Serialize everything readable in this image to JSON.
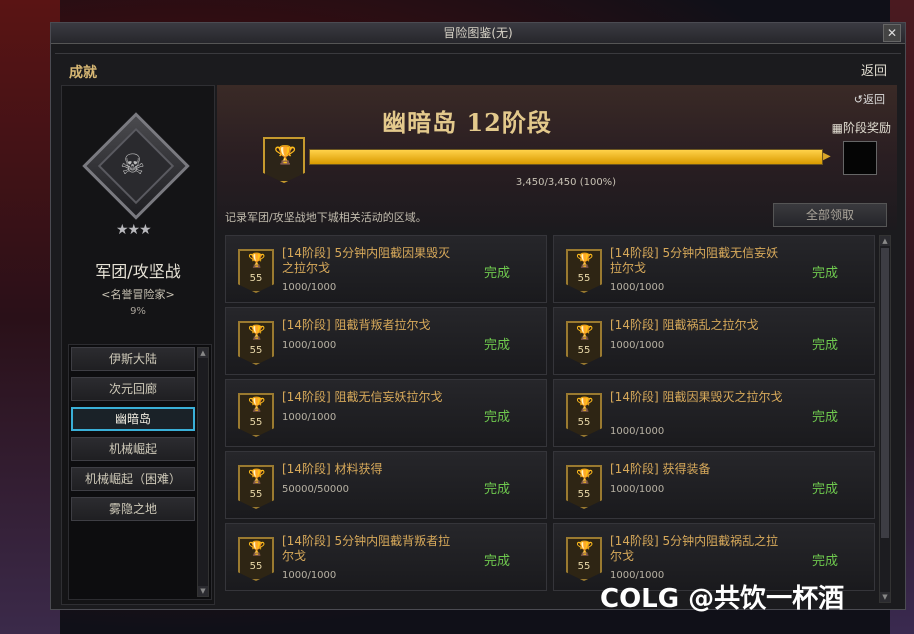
{
  "window": {
    "title": "冒险图鉴(无)"
  },
  "section": {
    "title": "成就",
    "return_label": "返回"
  },
  "left": {
    "rank_name": "军团/攻坚战",
    "rank_sub": "<名誉冒险家>",
    "rank_percent": "9%",
    "nav": [
      {
        "label": "伊斯大陆"
      },
      {
        "label": "次元回廊"
      },
      {
        "label": "幽暗岛"
      },
      {
        "label": "机械崛起"
      },
      {
        "label": "机械崛起（困难）"
      },
      {
        "label": "雾隐之地"
      }
    ],
    "active_index": 2
  },
  "main": {
    "area_title": "幽暗岛  12阶段",
    "return_label": "返回",
    "stage_reward_label": "阶段奖励",
    "progress_text": "3,450/3,450 (100%)",
    "progress_fraction": 1.0,
    "description": "记录军团/攻坚战地下城相关活动的区域。",
    "claim_all_label": "全部领取",
    "accent_color": "#f0b820",
    "complete_color": "#6ec84e"
  },
  "cards": [
    {
      "level": "55",
      "title": "[14阶段] 5分钟内阻截因果毁灭之拉尔戈",
      "progress": "1000/1000",
      "status": "完成"
    },
    {
      "level": "55",
      "title": "[14阶段] 5分钟内阻截无信妄妖拉尔戈",
      "progress": "1000/1000",
      "status": "完成"
    },
    {
      "level": "55",
      "title": "[14阶段] 阻截背叛者拉尔戈",
      "progress": "1000/1000",
      "status": "完成"
    },
    {
      "level": "55",
      "title": "[14阶段] 阻截祸乱之拉尔戈",
      "progress": "1000/1000",
      "status": "完成"
    },
    {
      "level": "55",
      "title": "[14阶段] 阻截无信妄妖拉尔戈",
      "progress": "1000/1000",
      "status": "完成"
    },
    {
      "level": "55",
      "title": "[14阶段] 阻截因果毁灭之拉尔戈",
      "progress": "1000/1000",
      "status": "完成"
    },
    {
      "level": "55",
      "title": "[14阶段] 材料获得",
      "progress": "50000/50000",
      "status": "完成"
    },
    {
      "level": "55",
      "title": "[14阶段] 获得装备",
      "progress": "1000/1000",
      "status": "完成"
    },
    {
      "level": "55",
      "title": "[14阶段] 5分钟内阻截背叛者拉尔戈",
      "progress": "1000/1000",
      "status": "完成"
    },
    {
      "level": "55",
      "title": "[14阶段] 5分钟内阻截祸乱之拉尔戈",
      "progress": "1000/1000",
      "status": "完成"
    }
  ],
  "watermark": "COLG @共饮一杯酒"
}
